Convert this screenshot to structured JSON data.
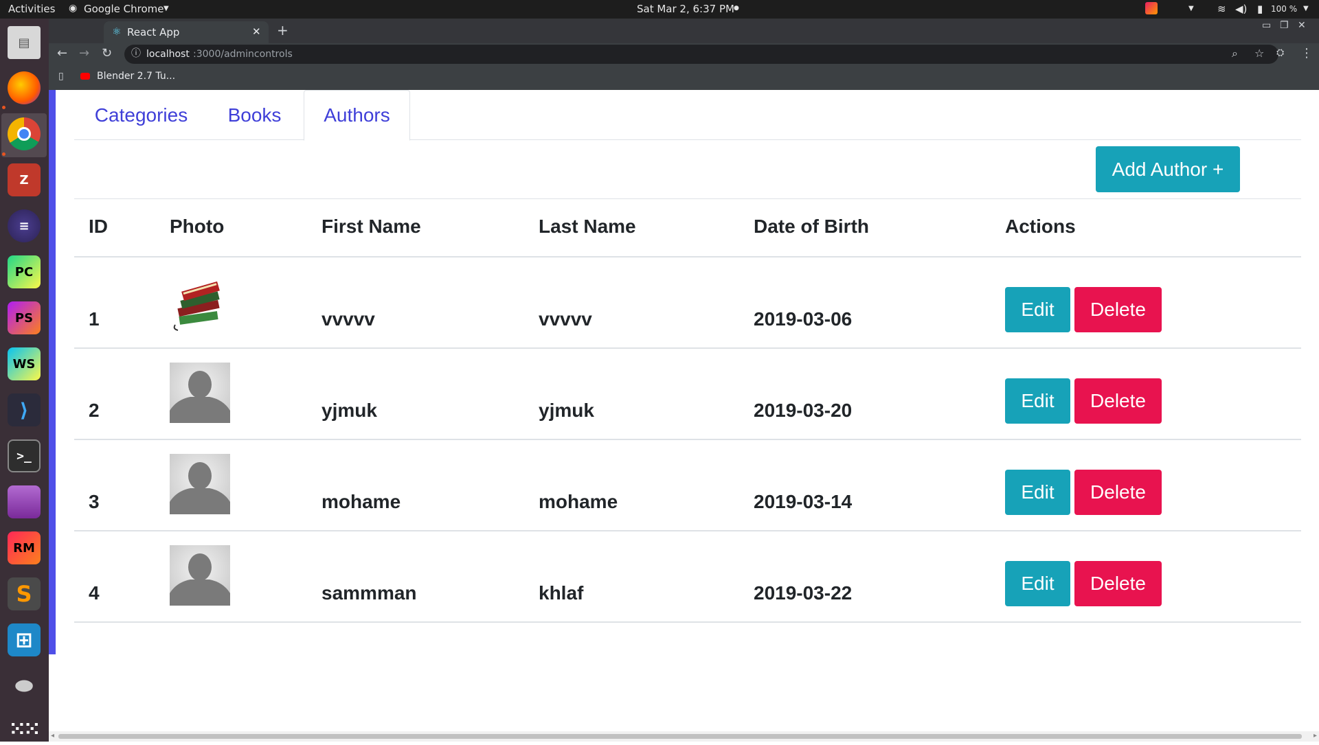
{
  "topbar": {
    "activities": "Activities",
    "app_name": "Google Chrome",
    "clock": "Sat Mar  2,  6:37 PM",
    "battery": "100 %"
  },
  "browser": {
    "tab_title": "React App",
    "url_host": "localhost",
    "url_path": ":3000/admincontrols",
    "bookmark": "Blender 2.7 Tu..."
  },
  "tabs": [
    {
      "label": "Categories"
    },
    {
      "label": "Books"
    },
    {
      "label": "Authors"
    }
  ],
  "add_author_label": "Add Author +",
  "table": {
    "headers": [
      "ID",
      "Photo",
      "First Name",
      "Last Name",
      "Date of Birth",
      "Actions"
    ],
    "rows": [
      {
        "id": "1",
        "first": "vvvvv",
        "last": "vvvvv",
        "dob": "2019-03-06",
        "photo": "books-image"
      },
      {
        "id": "2",
        "first": "yjmuk",
        "last": "yjmuk",
        "dob": "2019-03-20",
        "photo": "default-avatar"
      },
      {
        "id": "3",
        "first": "mohame",
        "last": "mohame",
        "dob": "2019-03-14",
        "photo": "default-avatar"
      },
      {
        "id": "4",
        "first": "sammman",
        "last": "khlaf",
        "dob": "2019-03-22",
        "photo": "default-avatar"
      }
    ],
    "edit_label": "Edit",
    "delete_label": "Delete"
  },
  "colors": {
    "info": "#17a2b8",
    "danger": "#e8134f",
    "link": "#3f3fd8"
  }
}
